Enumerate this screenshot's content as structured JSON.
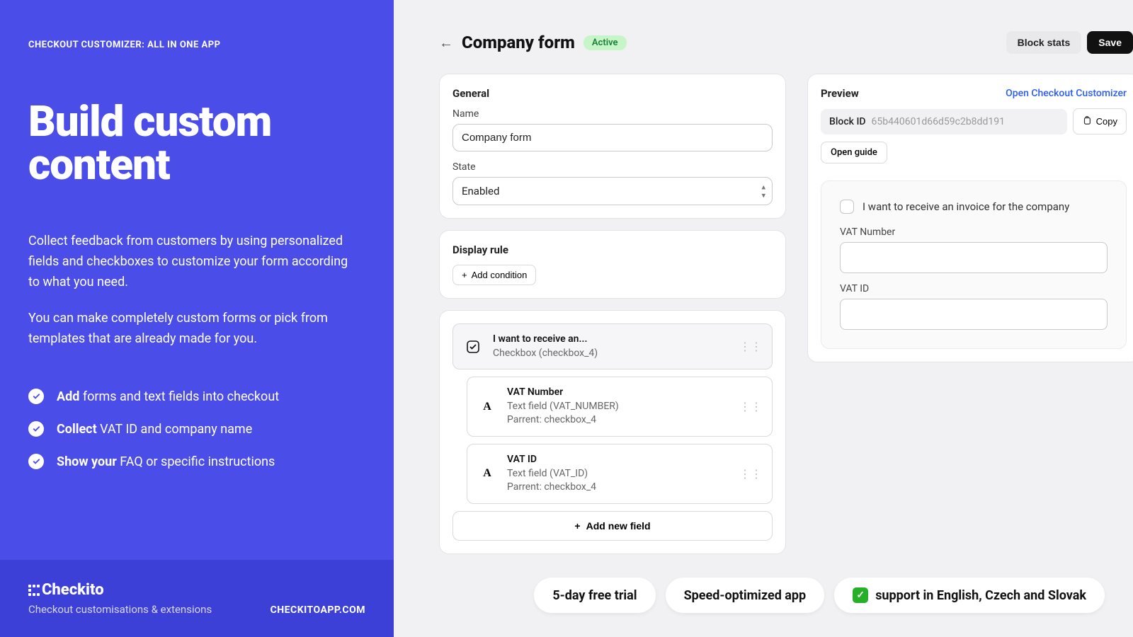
{
  "sidebar": {
    "tag": "CHECKOUT CUSTOMIZER: ALL IN ONE APP",
    "title": "Build custom content",
    "desc1": "Collect feedback from customers by using personalized fields and checkboxes to customize your form according to what you need.",
    "desc2": "You can make completely custom forms or pick from templates that are already made for you.",
    "bullets": [
      {
        "bold": "Add",
        "rest": " forms and text fields into checkout"
      },
      {
        "bold": "Collect",
        "rest": " VAT ID and company name"
      },
      {
        "bold": "Show your",
        "rest": " FAQ or specific instructions"
      }
    ],
    "logo": "Checkito",
    "sub": "Checkout customisations & extensions",
    "url": "CHECKITOAPP.COM"
  },
  "header": {
    "title": "Company form",
    "status": "Active",
    "stats": "Block stats",
    "save": "Save"
  },
  "general": {
    "heading": "General",
    "name_label": "Name",
    "name_value": "Company form",
    "state_label": "State",
    "state_value": "Enabled"
  },
  "display_rule": {
    "heading": "Display rule",
    "add": "Add condition"
  },
  "fields": {
    "root": {
      "title": "I want to receive an...",
      "meta": "Checkbox (checkbox_4)"
    },
    "children": [
      {
        "title": "VAT Number",
        "meta1": "Text field (VAT_NUMBER)",
        "meta2": "Parrent: checkbox_4"
      },
      {
        "title": "VAT ID",
        "meta1": "Text field (VAT_ID)",
        "meta2": "Parrent: checkbox_4"
      }
    ],
    "add_new": "Add new field"
  },
  "preview": {
    "heading": "Preview",
    "open_link": "Open Checkout Customizer",
    "block_label": "Block ID",
    "block_id": "65b440601d66d59c2b8dd191",
    "copy": "Copy",
    "guide": "Open guide",
    "checkbox_label": "I want to receive an invoice for the company",
    "vat_number": "VAT Number",
    "vat_id": "VAT ID"
  },
  "chips": {
    "trial": "5-day free trial",
    "speed": "Speed-optimized app",
    "support": "support in English, Czech and Slovak"
  }
}
